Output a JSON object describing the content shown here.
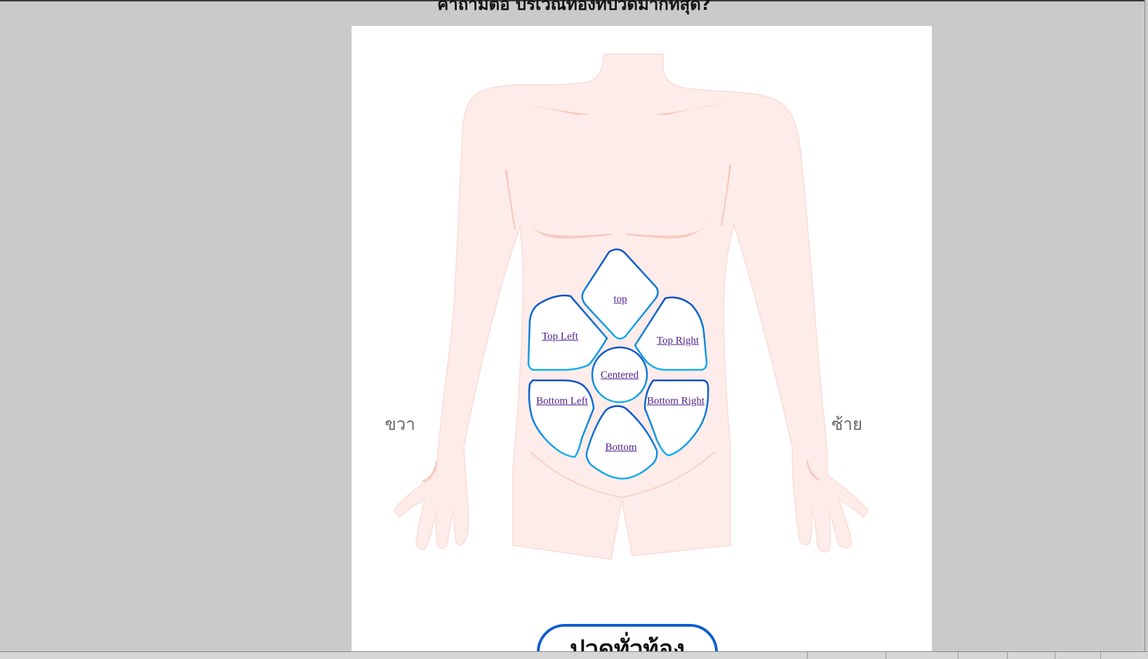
{
  "page": {
    "question": "คำถามต่อ บริเวณท้องที่ปวดมากที่สุด?"
  },
  "diagram": {
    "side_labels": {
      "right": "ขวา",
      "left": "ซ้าย"
    },
    "regions": {
      "top": "top",
      "top_left": "Top Left",
      "top_right": "Top Right",
      "centered": "Centered",
      "bottom_left": "Bottom Left",
      "bottom_right": "Bottom Right",
      "bottom": "Bottom"
    }
  },
  "buttons": {
    "whole_abdomen": "ปวดทั่วท้อง"
  },
  "colors": {
    "skin": "#fdecea",
    "skin_shadow": "#f7c9bd",
    "region_stroke_dark": "#0a4fc4",
    "region_stroke_light": "#12b0ec",
    "link": "#4b1e8a",
    "page_background": "#cacaca",
    "card_background": "#ffffff"
  }
}
